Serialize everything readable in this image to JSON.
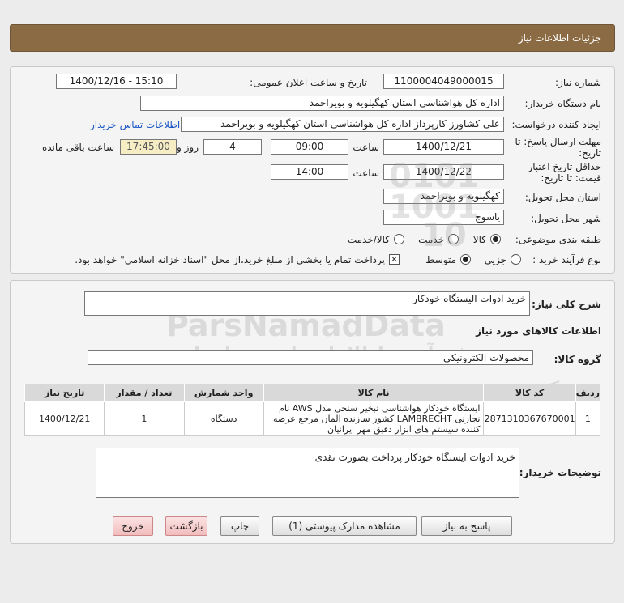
{
  "header": {
    "title": "جزئیات اطلاعات نیاز"
  },
  "form": {
    "need_number_label": "شماره نیاز:",
    "need_number": "1100004049000015",
    "announce_label": "تاریخ و ساعت اعلان عمومی:",
    "announce_value": "1400/12/16 - 15:10",
    "buyer_org_label": "نام دستگاه خریدار:",
    "buyer_org": "اداره کل هواشناسی استان کهگیلویه و بویراحمد",
    "creator_label": "ایجاد کننده درخواست:",
    "creator": "علی کشاورز کارپرداز اداره کل هواشناسی استان کهگیلویه و بویراحمد",
    "contact_link": "اطلاعات تماس خریدار",
    "reply_deadline_label": "مهلت ارسال پاسخ: تا تاریخ:",
    "reply_date": "1400/12/21",
    "time_label": "ساعت",
    "reply_time": "09:00",
    "days_value": "4",
    "days_label": "روز و",
    "remaining_time": "17:45:00",
    "remaining_label": "ساعت باقی مانده",
    "validity_label": "حداقل تاریخ اعتبار قیمت: تا تاریخ:",
    "validity_date": "1400/12/22",
    "validity_time": "14:00",
    "province_label": "استان محل تحویل:",
    "province": "کهگیلویه و بویراحمد",
    "city_label": "شهر محل تحویل:",
    "city": "یاسوج",
    "category_label": "طبقه بندی موضوعی:",
    "category_options": [
      "کالا",
      "خدمت",
      "کالا/خدمت"
    ],
    "process_label": "نوع فرآیند خرید :",
    "process_options": [
      "جزیی",
      "متوسط"
    ],
    "payment_note": "پرداخت تمام یا بخشی از مبلغ خرید،از محل \"اسناد خزانه اسلامی\" خواهد بود."
  },
  "summary": {
    "label": "شرح کلی نیاز:",
    "value": "خرید ادوات الیستگاه خودکار",
    "goods_info_title": "اطلاعات کالاهای مورد نیاز",
    "goods_group_label": "گروه کالا:",
    "goods_group": "محصولات الکترونیکی"
  },
  "table": {
    "headers": [
      "ردیف",
      "کد کالا",
      "نام کالا",
      "واحد شمارش",
      "تعداد / مقدار",
      "تاریخ نیاز"
    ],
    "rows": [
      {
        "row": "1",
        "code": "2871310367670001",
        "name": "ایستگاه خودکار هواشناسی تبخیر سنجی مدل AWS نام تجارتی LAMBRECHT کشور سازنده آلمان مرجع عرضه کننده سیستم های ابزار دقیق مهر ایرانیان",
        "unit": "دستگاه",
        "qty": "1",
        "date": "1400/12/21"
      }
    ]
  },
  "buyer_notes": {
    "label": "توضیحات خریدار:",
    "value": "خرید ادوات ایستگاه خودکار پرداخت بصورت نقدی"
  },
  "buttons": {
    "reply": "پاسخ به نیاز",
    "attachments": "مشاهده مدارک پیوستی (1)",
    "print": "چاپ",
    "back": "بازگشت",
    "exit": "خروج"
  },
  "watermark": {
    "brand": "ParsNamadData",
    "line1": "فن آوری اطلاعات پارس نماد داده",
    "line2": "پایگاه اطلاع رسانی مناقصات و مزایده",
    "phone": "۰۲۱-۸۸۳۴۶۰۰۰",
    "num1": "0101",
    "num2": "1001",
    "num3": "10"
  },
  "colors": {
    "header": "#8b6b44",
    "link": "#1a56c4",
    "highlight": "#f6edc5"
  }
}
